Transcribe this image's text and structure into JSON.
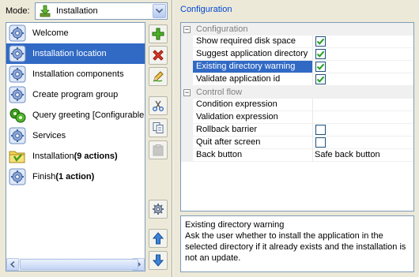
{
  "mode": {
    "label": "Mode:",
    "selected": "Installation",
    "icon": "download-arrow-icon"
  },
  "screens": [
    {
      "label": "Welcome",
      "suffix": "",
      "icon": "gear-screen-icon",
      "selected": false
    },
    {
      "label": "Installation location",
      "suffix": "",
      "icon": "gear-screen-icon",
      "selected": true
    },
    {
      "label": "Installation components",
      "suffix": "",
      "icon": "gear-screen-icon",
      "selected": false
    },
    {
      "label": "Create program group",
      "suffix": "",
      "icon": "gear-screen-icon",
      "selected": false
    },
    {
      "label": "Query greeting [Configurable",
      "suffix": "",
      "icon": "configurable-screen-icon",
      "selected": false
    },
    {
      "label": "Services",
      "suffix": "",
      "icon": "gear-screen-icon",
      "selected": false
    },
    {
      "label": "Installation ",
      "suffix": "(9 actions)",
      "icon": "folder-actions-icon",
      "selected": false
    },
    {
      "label": "Finish ",
      "suffix": "(1 action)",
      "icon": "gear-screen-icon",
      "selected": false
    }
  ],
  "toolbar": [
    {
      "name": "add-screen-button",
      "icon": "plus-icon",
      "enabled": true
    },
    {
      "name": "remove-screen-button",
      "icon": "delete-x-icon",
      "enabled": true
    },
    {
      "name": "rename-screen-button",
      "icon": "pencil-icon",
      "enabled": true
    },
    {
      "name": "cut-screen-button",
      "icon": "scissors-icon",
      "enabled": true
    },
    {
      "name": "copy-screen-button",
      "icon": "copy-icon",
      "enabled": true
    },
    {
      "name": "paste-screen-button",
      "icon": "paste-icon",
      "enabled": false
    },
    {
      "name": "screen-settings-button",
      "icon": "gear-icon",
      "enabled": true
    },
    {
      "name": "move-up-button",
      "icon": "arrow-up-icon",
      "enabled": true
    },
    {
      "name": "move-down-button",
      "icon": "arrow-down-icon",
      "enabled": true
    }
  ],
  "configuration": {
    "title": "Configuration",
    "categories": [
      {
        "name": "Configuration",
        "expanded": true,
        "properties": [
          {
            "name": "Show required disk space",
            "type": "checkbox",
            "checked": true,
            "value": "",
            "selected": false
          },
          {
            "name": "Suggest application directory",
            "type": "checkbox",
            "checked": true,
            "value": "",
            "selected": false
          },
          {
            "name": "Existing directory warning",
            "type": "checkbox",
            "checked": true,
            "value": "",
            "selected": true
          },
          {
            "name": "Validate application id",
            "type": "checkbox",
            "checked": true,
            "value": "",
            "selected": false
          }
        ]
      },
      {
        "name": "Control flow",
        "expanded": true,
        "properties": [
          {
            "name": "Condition expression",
            "type": "text",
            "checked": false,
            "value": "",
            "selected": false
          },
          {
            "name": "Validation expression",
            "type": "text",
            "checked": false,
            "value": "",
            "selected": false
          },
          {
            "name": "Rollback barrier",
            "type": "checkbox",
            "checked": false,
            "value": "",
            "selected": false
          },
          {
            "name": "Quit after screen",
            "type": "checkbox",
            "checked": false,
            "value": "",
            "selected": false
          },
          {
            "name": "Back button",
            "type": "text",
            "checked": false,
            "value": "Safe back button",
            "selected": false
          }
        ]
      }
    ]
  },
  "description": {
    "title": "Existing directory warning",
    "text": "Ask the user whether to install the application in the selected directory if it already exists and the installation is not an update."
  },
  "colors": {
    "selection": "#316ac5",
    "group_title": "#0046d5",
    "window_bg": "#ece9d8"
  }
}
